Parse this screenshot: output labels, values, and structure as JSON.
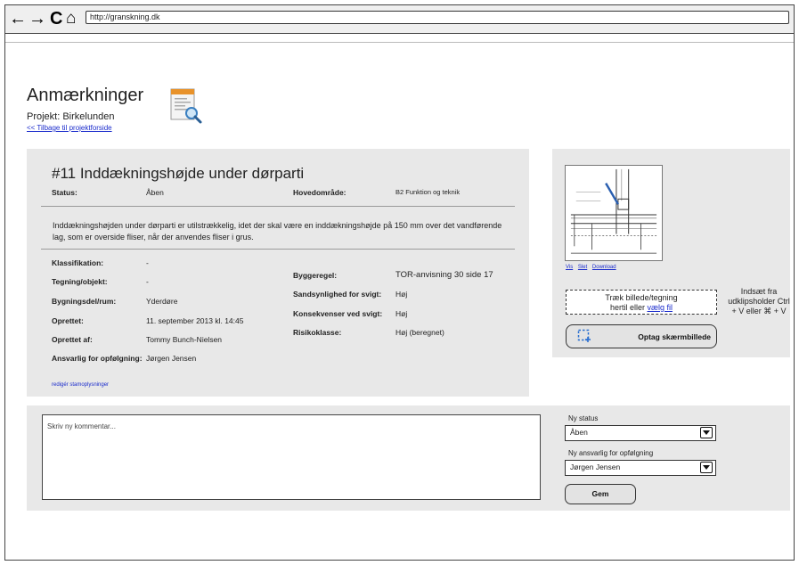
{
  "browser": {
    "url": "http://granskning.dk",
    "back_glyph": "←",
    "forward_glyph": "→",
    "reload_glyph": "C",
    "home_glyph": "⌂"
  },
  "header": {
    "title": "Anmærkninger",
    "project": "Projekt: Birkelunden",
    "back_link": "<< Tilbage til projektforside",
    "icon": "document-search-icon"
  },
  "issue": {
    "title": "#11  Inddækningshøjde under dørparti",
    "status_label": "Status:",
    "status_value": "Åben",
    "area_label": "Hovedområde:",
    "area_value": "B2 Funktion og teknik",
    "description": "Inddækningshøjden under dørparti er utilstrækkelig, idet der skal være en inddækningshøjde på 150 mm over det vandførende lag, som er overside fliser, når der anvendes fliser i grus.",
    "left_fields": [
      {
        "label": "Klassifikation:",
        "value": "-"
      },
      {
        "label": "Tegning/objekt:",
        "value": "-"
      },
      {
        "label": "Bygningsdel/rum:",
        "value": "Yderdøre"
      },
      {
        "label": "Oprettet:",
        "value": "11. september 2013 kl. 14:45"
      },
      {
        "label": "Oprettet af:",
        "value": "Tommy Bunch-Nielsen"
      },
      {
        "label": "Ansvarlig for opfølgning:",
        "value": "Jørgen Jensen"
      }
    ],
    "right_fields": [
      {
        "label": "Byggeregel:",
        "value": "TOR-anvisning 30 side 17"
      },
      {
        "label": "Sandsynlighed for svigt:",
        "value": "Høj"
      },
      {
        "label": "Konsekvenser ved svigt:",
        "value": "Høj"
      },
      {
        "label": "Risikoklasse:",
        "value": "Høj (beregnet)"
      }
    ],
    "edit_link": "redigér stamoplysninger"
  },
  "attachment": {
    "links": [
      "Vis",
      "Slet",
      "Download"
    ],
    "drop_line1": "Træk billede/tegning",
    "drop_line2_prefix": "hertil eller ",
    "drop_choose": "vælg fil",
    "paste_hint": "Indsæt fra udklipsholder Ctrl + V eller ⌘ + V",
    "record_button": "Optag skærmbillede"
  },
  "comment": {
    "placeholder": "Skriv ny kommentar...",
    "new_status_label": "Ny status",
    "new_status_value": "Åben",
    "responsible_label": "Ny ansvarlig for opfølgning",
    "responsible_value": "Jørgen Jensen",
    "save_button": "Gem"
  },
  "colors": {
    "panel": "#e8e8e8",
    "link": "#1a2bcc",
    "border": "#444444"
  }
}
